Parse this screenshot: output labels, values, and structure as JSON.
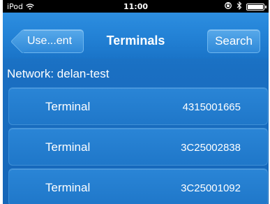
{
  "status_bar": {
    "carrier": "iPod",
    "wifi_icon": "wifi-icon",
    "time": "11:00",
    "right_icons": [
      "rotation-lock-icon",
      "bluetooth-icon",
      "battery-icon"
    ]
  },
  "nav_bar": {
    "back_label": "Use...ent",
    "title": "Terminals",
    "search_label": "Search"
  },
  "network": {
    "label": "Network: delan-test"
  },
  "terminals": [
    {
      "name": "Terminal",
      "id": "4315001665"
    },
    {
      "name": "Terminal",
      "id": "3C25002838"
    },
    {
      "name": "Terminal",
      "id": "3C25001092"
    }
  ]
}
